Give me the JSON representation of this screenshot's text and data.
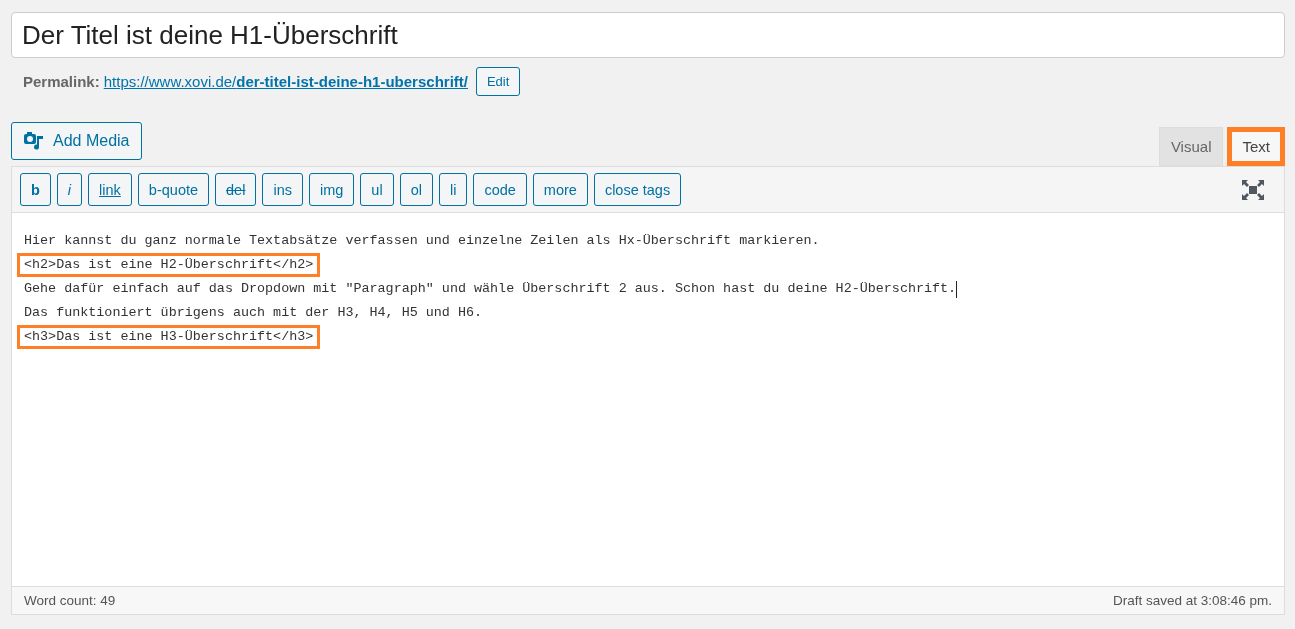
{
  "title_field": {
    "value": "Der Titel ist deine H1-Überschrift"
  },
  "permalink": {
    "label": "Permalink:",
    "base_url": "https://www.xovi.de/",
    "slug": "der-titel-ist-deine-h1-uberschrift/",
    "edit_button": "Edit"
  },
  "add_media_button": "Add Media",
  "tabs": [
    {
      "label": "Visual",
      "selected": false,
      "highlighted": false
    },
    {
      "label": "Text",
      "selected": true,
      "highlighted": true
    }
  ],
  "toolbar": [
    {
      "label": "b",
      "kind": "bold"
    },
    {
      "label": "i",
      "kind": "italic"
    },
    {
      "label": "link",
      "kind": "link"
    },
    {
      "label": "b-quote",
      "kind": "plain"
    },
    {
      "label": "del",
      "kind": "strike"
    },
    {
      "label": "ins",
      "kind": "plain"
    },
    {
      "label": "img",
      "kind": "plain"
    },
    {
      "label": "ul",
      "kind": "plain"
    },
    {
      "label": "ol",
      "kind": "plain"
    },
    {
      "label": "li",
      "kind": "plain"
    },
    {
      "label": "code",
      "kind": "plain"
    },
    {
      "label": "more",
      "kind": "plain"
    },
    {
      "label": "close tags",
      "kind": "plain"
    }
  ],
  "content_lines": [
    {
      "text": "Hier kannst du ganz normale Textabsätze verfassen und einzelne Zeilen als Hx-Überschrift markieren.",
      "highlighted": false,
      "cursor": false
    },
    {
      "text": "<h2>Das ist eine H2-Überschrift</h2>",
      "highlighted": true,
      "cursor": false
    },
    {
      "text": "Gehe dafür einfach auf das Dropdown mit \"Paragraph\" und wähle Überschrift 2 aus. Schon hast du deine H2-Überschrift.",
      "highlighted": false,
      "cursor": true
    },
    {
      "text": "Das funktioniert übrigens auch mit der H3, H4, H5 und H6.",
      "highlighted": false,
      "cursor": false
    },
    {
      "text": "<h3>Das ist eine H3-Überschrift</h3>",
      "highlighted": true,
      "cursor": false
    }
  ],
  "status_bar": {
    "word_count": "Word count: 49",
    "saved": "Draft saved at 3:08:46 pm."
  }
}
